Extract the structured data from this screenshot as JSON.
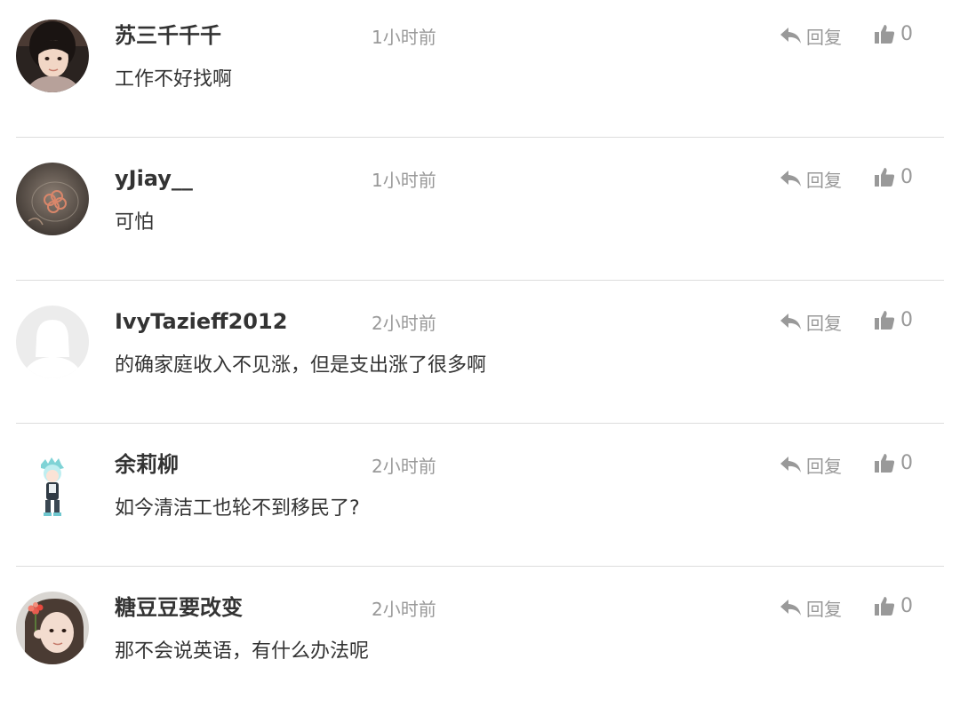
{
  "comments": [
    {
      "username": "苏三千千千",
      "time": "1小时前",
      "reply_label": "回复",
      "likes": "0",
      "content": "工作不好找啊"
    },
    {
      "username": "yJiay__",
      "time": "1小时前",
      "reply_label": "回复",
      "likes": "0",
      "content": "可怕"
    },
    {
      "username": "IvyTazieff2012",
      "time": "2小时前",
      "reply_label": "回复",
      "likes": "0",
      "content": "的确家庭收入不见涨，但是支出涨了很多啊"
    },
    {
      "username": "余莉柳",
      "time": "2小时前",
      "reply_label": "回复",
      "likes": "0",
      "content": "如今清洁工也轮不到移民了?"
    },
    {
      "username": "糖豆豆要改变",
      "time": "2小时前",
      "reply_label": "回复",
      "likes": "0",
      "content": "那不会说英语，有什么办法呢"
    }
  ],
  "icons": {
    "reply": "reply-arrow-icon",
    "like": "thumbs-up-icon"
  },
  "colors": {
    "username": "#333333",
    "meta": "#999999",
    "divider": "#dddddd"
  }
}
